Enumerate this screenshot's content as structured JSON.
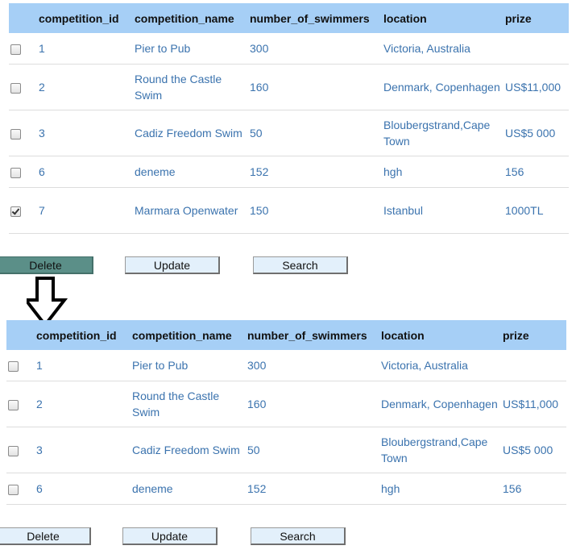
{
  "columns": [
    "competition_id",
    "competition_name",
    "number_of_swimmers",
    "location",
    "prize"
  ],
  "buttons": {
    "delete": "Delete",
    "update": "Update",
    "search": "Search"
  },
  "top_table": {
    "rows": [
      {
        "checked": false,
        "competition_id": "1",
        "competition_name": "Pier to Pub",
        "number_of_swimmers": "300",
        "location": "Victoria, Australia",
        "prize": ""
      },
      {
        "checked": false,
        "competition_id": "2",
        "competition_name": "Round the Castle Swim",
        "number_of_swimmers": "160",
        "location": "Denmark, Copenhagen",
        "prize": "US$11,000"
      },
      {
        "checked": false,
        "competition_id": "3",
        "competition_name": "Cadiz Freedom Swim",
        "number_of_swimmers": "50",
        "location": "Bloubergstrand,Cape Town",
        "prize": "US$5 000"
      },
      {
        "checked": false,
        "competition_id": "6",
        "competition_name": "deneme",
        "number_of_swimmers": "152",
        "location": "hgh",
        "prize": "156"
      },
      {
        "checked": true,
        "competition_id": "7",
        "competition_name": "Marmara Openwater",
        "number_of_swimmers": "150",
        "location": "Istanbul",
        "prize": "1000TL"
      }
    ]
  },
  "bottom_table": {
    "rows": [
      {
        "checked": false,
        "competition_id": "1",
        "competition_name": "Pier to Pub",
        "number_of_swimmers": "300",
        "location": "Victoria, Australia",
        "prize": ""
      },
      {
        "checked": false,
        "competition_id": "2",
        "competition_name": "Round the Castle Swim",
        "number_of_swimmers": "160",
        "location": "Denmark, Copenhagen",
        "prize": "US$11,000"
      },
      {
        "checked": false,
        "competition_id": "3",
        "competition_name": "Cadiz Freedom Swim",
        "number_of_swimmers": "50",
        "location": "Bloubergstrand,Cape Town",
        "prize": "US$5 000"
      },
      {
        "checked": false,
        "competition_id": "6",
        "competition_name": "deneme",
        "number_of_swimmers": "152",
        "location": "hgh",
        "prize": "156"
      }
    ]
  },
  "icons": {
    "arrow": "down-arrow-icon"
  },
  "colors": {
    "header_bg": "#a6cff6",
    "link_text": "#3b73ae",
    "button_bg": "#e3f0fb",
    "active_button_bg": "#5b8f88"
  }
}
